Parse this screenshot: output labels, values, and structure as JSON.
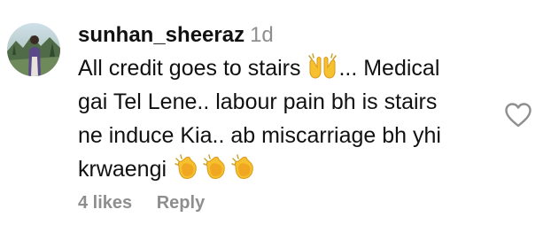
{
  "comment": {
    "username": "sunhan_sheeraz",
    "timestamp": "1d",
    "text_lines": [
      "All credit goes to stairs",
      "... Medical",
      "gai Tel Lene.. labour pain bh is stairs",
      "ne induce Kia.. ab miscarriage bh yhi",
      "krwaengi"
    ],
    "emojis": {
      "line1": "raising-hands-emoji",
      "line5": [
        "clapping-hands-emoji",
        "clapping-hands-emoji",
        "clapping-hands-emoji"
      ]
    },
    "likes": "4 likes",
    "reply_label": "Reply",
    "like_icon": "heart-outline-icon"
  },
  "colors": {
    "username": "#111111",
    "muted": "#8e8e8e",
    "emoji_yellow": "#f7c02f"
  }
}
